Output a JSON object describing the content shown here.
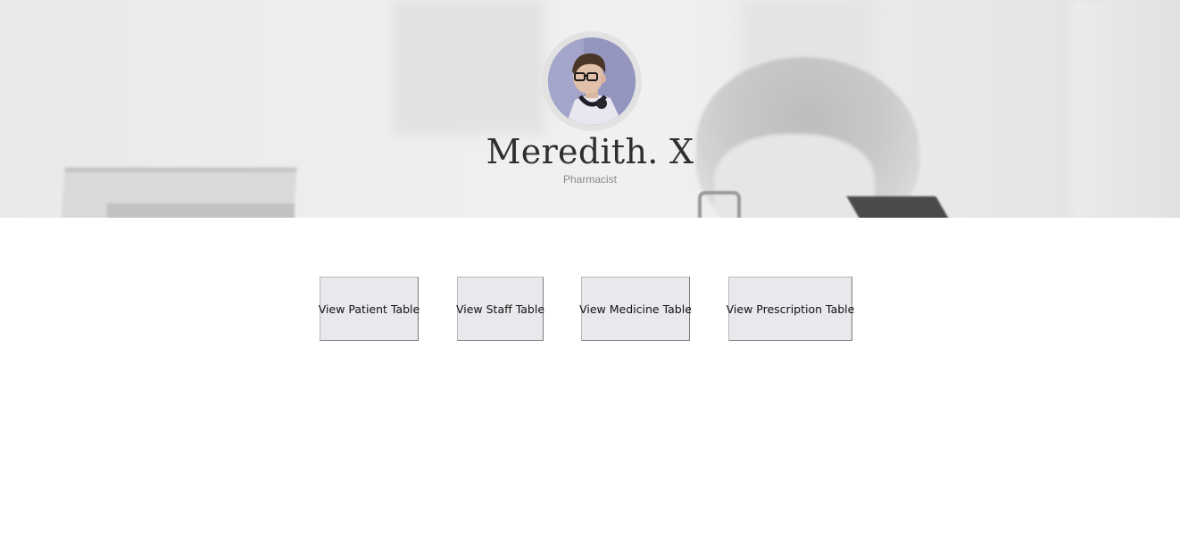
{
  "profile": {
    "name": "Meredith. X",
    "role": "Pharmacist"
  },
  "actions": {
    "patient_label": "View Patient Table",
    "staff_label": "View Staff Table",
    "medicine_label": "View Medicine Table",
    "prescription_label": "View Prescription Table"
  },
  "colors": {
    "button_background": "#e9e8ec",
    "name_text": "#2f2f2f",
    "role_text": "#8a8a8a"
  }
}
